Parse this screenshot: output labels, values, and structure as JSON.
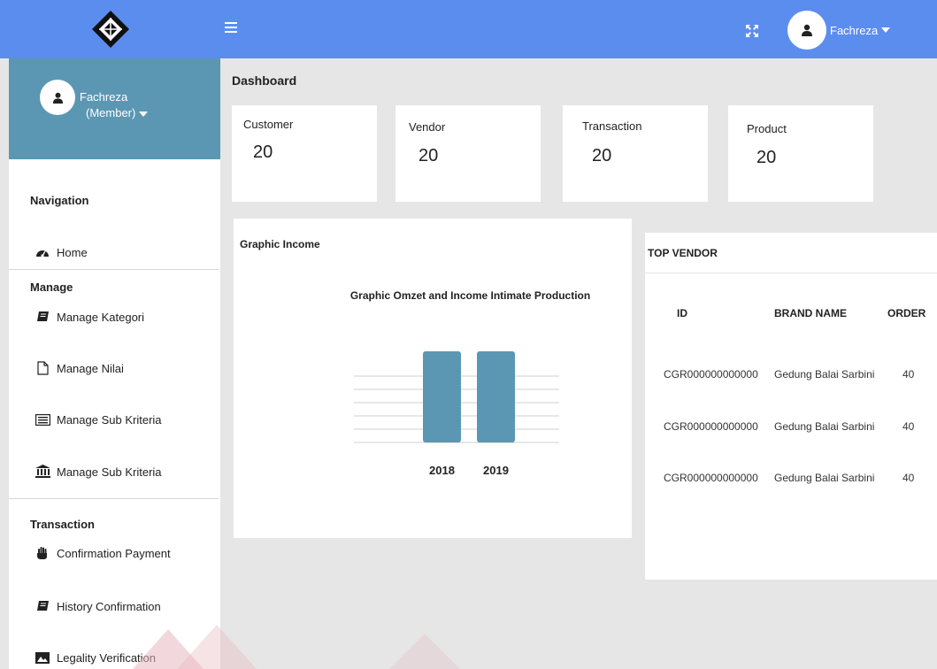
{
  "header": {
    "user_name": "Fachreza",
    "menu_icon": "hamburger-icon",
    "expand_icon": "expand-icon",
    "logo_icon": "diamond-logo"
  },
  "sidebar": {
    "profile_name": "Fachreza",
    "profile_role": "(Member)",
    "sections": {
      "navigation": "Navigation",
      "manage": "Manage",
      "transaction": "Transaction"
    },
    "items": [
      {
        "label": "Home",
        "icon": "dashboard-gauge-icon"
      },
      {
        "label": "Manage Kategori",
        "icon": "book-icon"
      },
      {
        "label": "Manage Nilai",
        "icon": "file-icon"
      },
      {
        "label": "Manage Sub Kriteria",
        "icon": "list-alt-icon"
      },
      {
        "label": "Manage Sub Kriteria",
        "icon": "bank-icon"
      },
      {
        "label": "Confirmation Payment",
        "icon": "hand-icon"
      },
      {
        "label": "History Confirmation",
        "icon": "book-icon"
      },
      {
        "label": "Legality Verification",
        "icon": "image-icon"
      }
    ]
  },
  "main": {
    "title": "Dashboard",
    "stats": [
      {
        "label": "Customer",
        "value": "20"
      },
      {
        "label": "Vendor",
        "value": "20"
      },
      {
        "label": "Transaction",
        "value": "20"
      },
      {
        "label": "Product",
        "value": "20"
      }
    ],
    "income_card_title": "Graphic Income",
    "vendor_card_title": "TOP VENDOR",
    "vendor_table": {
      "headers": [
        "ID",
        "BRAND NAME",
        "ORDER"
      ],
      "rows": [
        [
          "CGR000000000000",
          "Gedung Balai Sarbini",
          "40"
        ],
        [
          "CGR000000000000",
          "Gedung Balai Sarbini",
          "40"
        ],
        [
          "CGR000000000000",
          "Gedung Balai Sarbini",
          "40"
        ]
      ]
    }
  },
  "chart_data": {
    "type": "bar",
    "title": "Graphic Omzet and Income Intimate Production",
    "categories": [
      "2018",
      "2019"
    ],
    "values": [
      7,
      7
    ],
    "ylim": [
      0,
      7
    ],
    "grid": true,
    "bar_color": "#5b97b3"
  },
  "colors": {
    "topbar": "#5b8def",
    "profile_bg": "#5b97b3",
    "page_bg": "#e6e6e6"
  }
}
